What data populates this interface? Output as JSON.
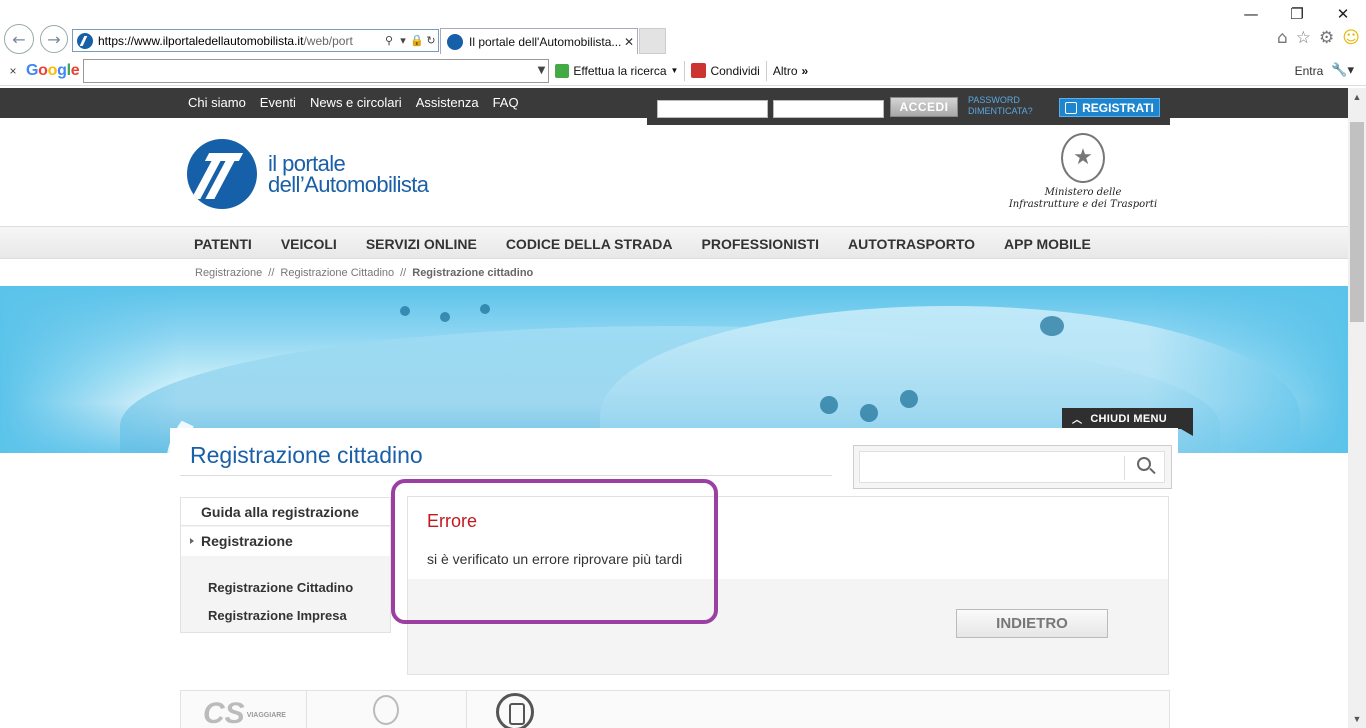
{
  "browser": {
    "url_domain": "https://www.ilportaledellautomobilista.it",
    "url_rest": "/web/port",
    "tab_title": "Il portale dell'Automobilista...",
    "window_controls": {
      "minimize": "—",
      "restore": "❐",
      "close": "✕"
    }
  },
  "google_toolbar": {
    "close": "×",
    "logo_letters": [
      "G",
      "o",
      "o",
      "g",
      "l",
      "e"
    ],
    "search_value": "",
    "search_label": "Effettua la ricerca",
    "share_label": "Condividi",
    "more_label": "Altro",
    "signin_label": "Entra"
  },
  "site": {
    "top_links": [
      "Chi siamo",
      "Eventi",
      "News e circolari",
      "Assistenza",
      "FAQ"
    ],
    "login": {
      "username_value": "",
      "password_value": "",
      "accedi_label": "ACCEDI",
      "forgot_line1": "PASSWORD",
      "forgot_line2": "DIMENTICATA?",
      "register_label": "REGISTRATI"
    },
    "logo_line1": "il portale",
    "logo_line2": "dell’Automobilista",
    "ministry_line1": "Ministero delle",
    "ministry_line2": "Infrastrutture e dei Trasporti",
    "main_nav": [
      "PATENTI",
      "VEICOLI",
      "SERVIZI ONLINE",
      "CODICE DELLA STRADA",
      "PROFESSIONISTI",
      "AUTOTRASPORTO",
      "APP MOBILE"
    ],
    "breadcrumb": [
      "Registrazione",
      "Registrazione Cittadino",
      "Registrazione cittadino"
    ],
    "breadcrumb_sep": "//",
    "close_menu_label": "CHIUDI MENU",
    "page_title": "Registrazione cittadino",
    "search_value": "",
    "sidebar": {
      "header": "Guida alla registrazione",
      "active": "Registrazione",
      "sub_items": [
        "Registrazione Cittadino",
        "Registrazione Impresa"
      ]
    },
    "error": {
      "title": "Errore",
      "message": "si è verificato un errore riprovare più tardi"
    },
    "back_button": "INDIETRO",
    "footer_logo1": "CS",
    "footer_logo1_sub": "VIAGGIARE"
  },
  "colors": {
    "accent_blue": "#1a5fa8",
    "error_red": "#c0191e",
    "highlight_purple": "#9b3fa3",
    "topbar": "#3a3a3a"
  }
}
